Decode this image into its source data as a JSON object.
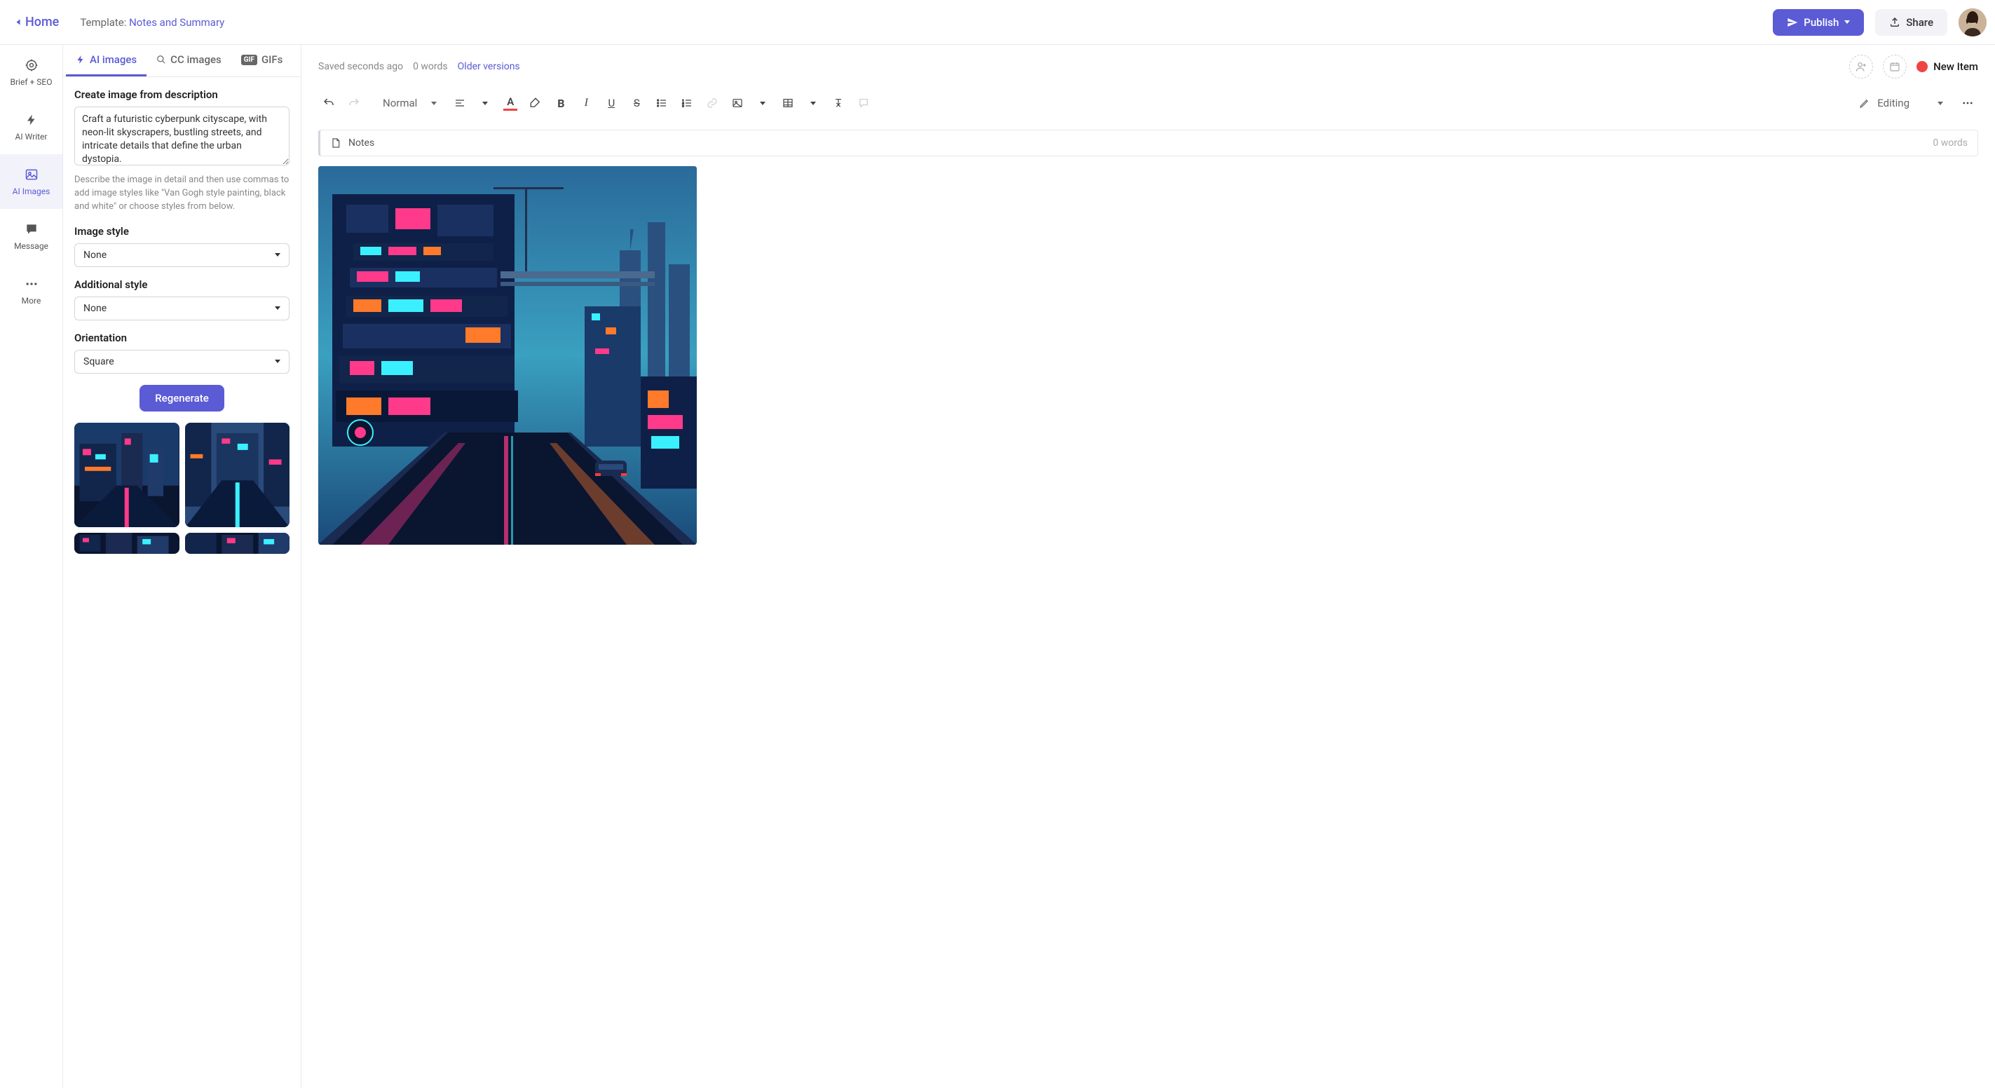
{
  "topbar": {
    "home": "Home",
    "template_prefix": "Template: ",
    "template_name": "Notes and Summary",
    "publish": "Publish",
    "share": "Share"
  },
  "vnav": {
    "brief": "Brief + SEO",
    "writer": "AI Writer",
    "images": "AI Images",
    "message": "Message",
    "more": "More"
  },
  "panel_tabs": {
    "ai_images": "AI images",
    "cc_images": "CC images",
    "gifs": "GIFs"
  },
  "panel": {
    "create_label": "Create image from description",
    "description_value": "Craft a futuristic cyberpunk cityscape, with neon-lit skyscrapers, bustling streets, and intricate details that define the urban dystopia.",
    "help": "Describe the image in detail and then use commas to add image styles like \"Van Gogh style painting, black and white\" or choose styles from below.",
    "image_style_label": "Image style",
    "image_style_value": "None",
    "additional_style_label": "Additional style",
    "additional_style_value": "None",
    "orientation_label": "Orientation",
    "orientation_value": "Square",
    "regenerate": "Regenerate"
  },
  "editor": {
    "saved": "Saved seconds ago",
    "words_top": "0 words",
    "older": "Older versions",
    "new_item": "New Item",
    "para_style": "Normal",
    "editing_mode": "Editing",
    "notes_label": "Notes",
    "notes_words": "0 words"
  }
}
